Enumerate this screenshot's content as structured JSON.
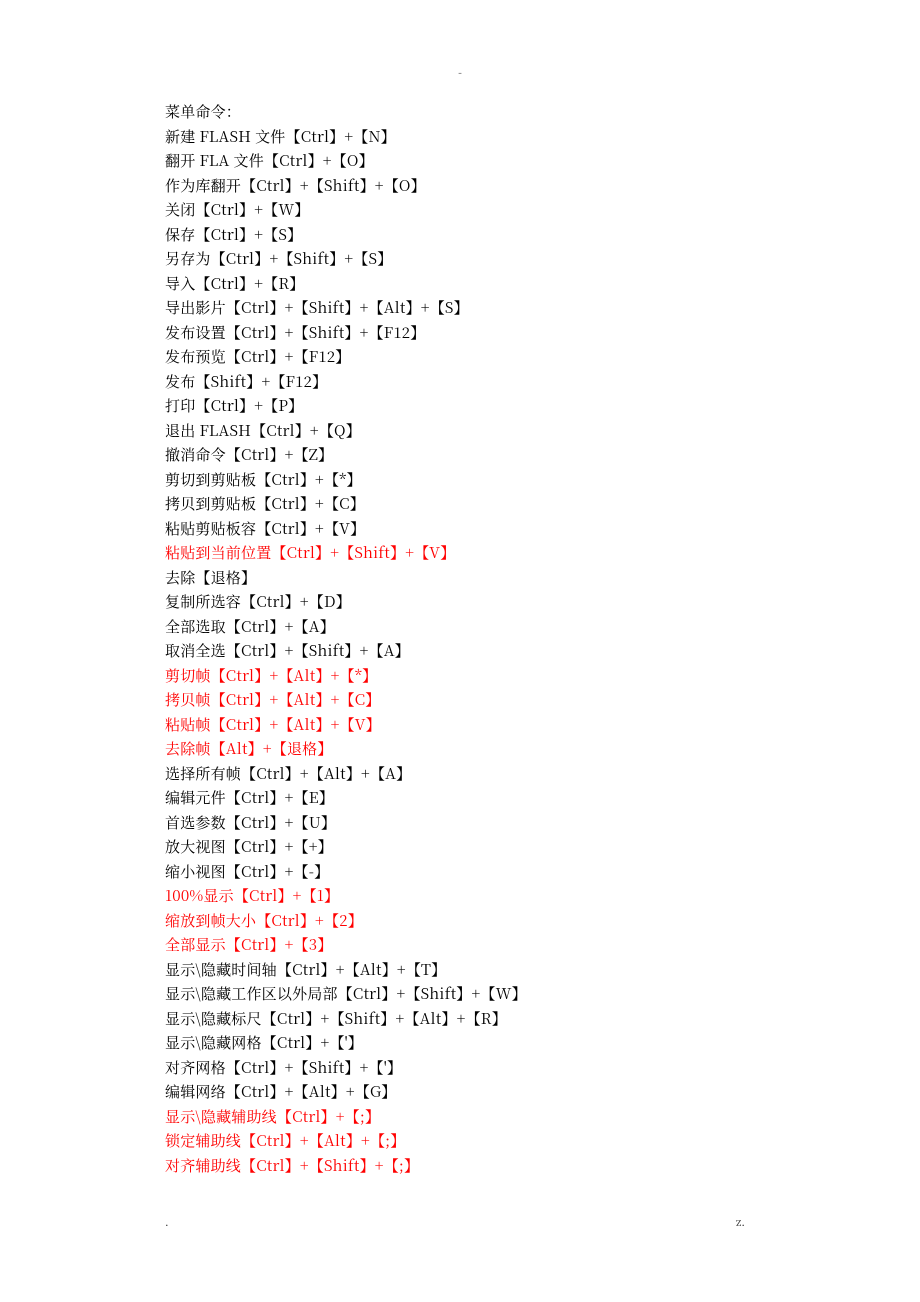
{
  "top_marker": "-",
  "footer_left": ".",
  "footer_right": "z.",
  "lines": [
    {
      "text": "菜单命令：",
      "red": false
    },
    {
      "text": "新建 FLASH 文件【Ctrl】+【N】",
      "red": false
    },
    {
      "text": "翻开 FLA 文件【Ctrl】+【O】",
      "red": false
    },
    {
      "text": "作为库翻开【Ctrl】+【Shift】+【O】",
      "red": false
    },
    {
      "text": "关闭【Ctrl】+【W】",
      "red": false
    },
    {
      "text": "保存【Ctrl】+【S】",
      "red": false
    },
    {
      "text": "另存为【Ctrl】+【Shift】+【S】",
      "red": false
    },
    {
      "text": "导入【Ctrl】+【R】",
      "red": false
    },
    {
      "text": "导出影片【Ctrl】+【Shift】+【Alt】+【S】",
      "red": false
    },
    {
      "text": "发布设置【Ctrl】+【Shift】+【F12】",
      "red": false
    },
    {
      "text": "发布预览【Ctrl】+【F12】",
      "red": false
    },
    {
      "text": "发布【Shift】+【F12】",
      "red": false
    },
    {
      "text": "打印【Ctrl】+【P】",
      "red": false
    },
    {
      "text": "退出 FLASH【Ctrl】+【Q】",
      "red": false
    },
    {
      "text": "撤消命令【Ctrl】+【Z】",
      "red": false
    },
    {
      "text": "剪切到剪贴板【Ctrl】+【*】",
      "red": false
    },
    {
      "text": "拷贝到剪贴板【Ctrl】+【C】",
      "red": false
    },
    {
      "text": "粘贴剪贴板容【Ctrl】+【V】",
      "red": false
    },
    {
      "text": "粘贴到当前位置【Ctrl】+【Shift】+【V】",
      "red": true
    },
    {
      "text": "去除【退格】",
      "red": false
    },
    {
      "text": "复制所选容【Ctrl】+【D】",
      "red": false
    },
    {
      "text": "全部选取【Ctrl】+【A】",
      "red": false
    },
    {
      "text": "取消全选【Ctrl】+【Shift】+【A】",
      "red": false
    },
    {
      "text": "剪切帧【Ctrl】+【Alt】+【*】",
      "red": true
    },
    {
      "text": "拷贝帧【Ctrl】+【Alt】+【C】",
      "red": true
    },
    {
      "text": "粘贴帧【Ctrl】+【Alt】+【V】",
      "red": true
    },
    {
      "text": "去除帧【Alt】+【退格】",
      "red": true
    },
    {
      "text": "选择所有帧【Ctrl】+【Alt】+【A】",
      "red": false
    },
    {
      "text": "编辑元件【Ctrl】+【E】",
      "red": false
    },
    {
      "text": "首选参数【Ctrl】+【U】",
      "red": false
    },
    {
      "text": "放大视图【Ctrl】+【+】",
      "red": false
    },
    {
      "text": "缩小视图【Ctrl】+【-】",
      "red": false
    },
    {
      "text": "100%显示【Ctrl】+【1】",
      "red": true
    },
    {
      "text": "缩放到帧大小【Ctrl】+【2】",
      "red": true
    },
    {
      "text": "全部显示【Ctrl】+【3】",
      "red": true
    },
    {
      "text": "显示\\隐藏时间轴【Ctrl】+【Alt】+【T】",
      "red": false
    },
    {
      "text": "显示\\隐藏工作区以外局部【Ctrl】+【Shift】+【W】",
      "red": false
    },
    {
      "text": "显示\\隐藏标尺【Ctrl】+【Shift】+【Alt】+【R】",
      "red": false
    },
    {
      "text": "显示\\隐藏网格【Ctrl】+【'】",
      "red": false
    },
    {
      "text": "对齐网格【Ctrl】+【Shift】+【'】",
      "red": false
    },
    {
      "text": "编辑网络【Ctrl】+【Alt】+【G】",
      "red": false
    },
    {
      "text": "显示\\隐藏辅助线【Ctrl】+【;】",
      "red": true
    },
    {
      "text": "锁定辅助线【Ctrl】+【Alt】+【;】",
      "red": true
    },
    {
      "text": "对齐辅助线【Ctrl】+【Shift】+【;】",
      "red": true
    }
  ]
}
